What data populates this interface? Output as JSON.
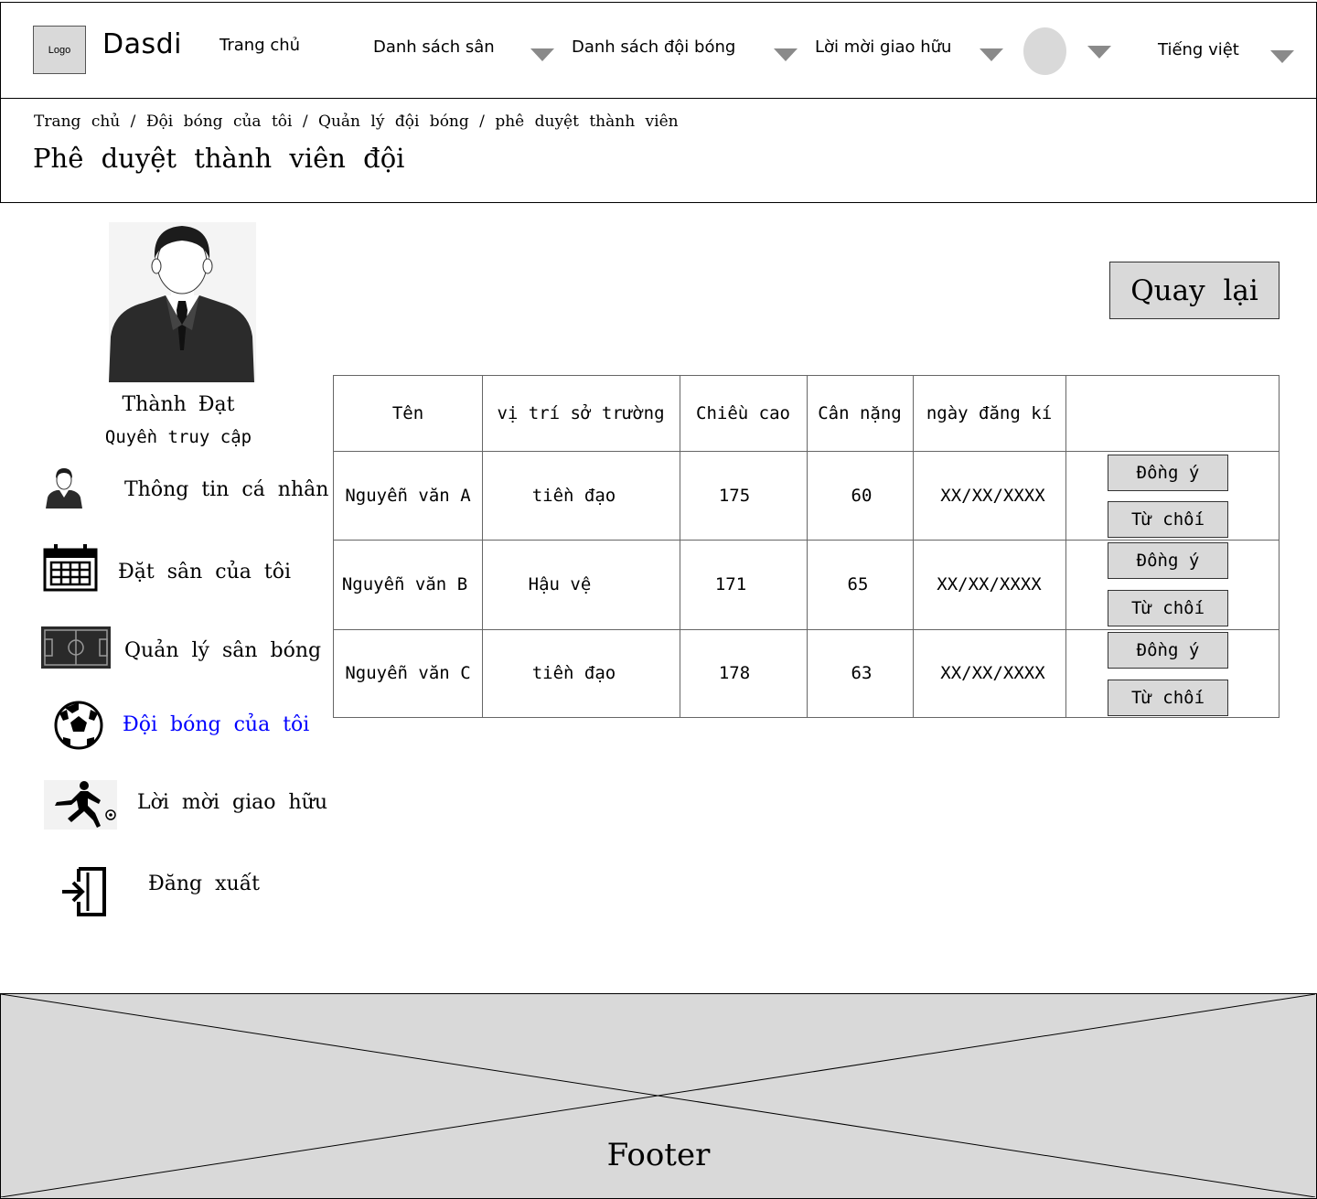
{
  "header": {
    "logo": "Logo",
    "brand": "Dasdi",
    "nav": {
      "home": "Trang chủ",
      "fields": "Danh sách sân",
      "teams": "Danh sách đội bóng",
      "invites": "Lời mời giao hữu",
      "language": "Tiếng việt"
    }
  },
  "breadcrumb": {
    "items": [
      "Trang chủ",
      "Đội bóng của tôi",
      "Quản lý đội bóng",
      "phê duyệt thành viên"
    ],
    "separator": "/"
  },
  "page_title": "Phê duyệt thành viên đội",
  "profile": {
    "name": "Thành Đạt",
    "role": "Quyền truy cập"
  },
  "sidebar": {
    "items": [
      {
        "label": "Thông tin cá nhân",
        "icon": "person-icon"
      },
      {
        "label": "Đặt sân của tôi",
        "icon": "calendar-icon"
      },
      {
        "label": "Quản lý sân bóng",
        "icon": "soccer-field-icon"
      },
      {
        "label": "Đội bóng của tôi",
        "icon": "soccer-ball-icon",
        "active": true
      },
      {
        "label": "Lời mời giao hữu",
        "icon": "soccer-player-icon"
      },
      {
        "label": "Đăng xuất",
        "icon": "logout-icon"
      }
    ],
    "active_color": "#0000ff"
  },
  "back_button": "Quay lại",
  "table": {
    "headers": [
      "Tên",
      "vị trí sở trường",
      "Chiều cao",
      "Cân nặng",
      "ngày đăng kí",
      ""
    ],
    "rows": [
      {
        "name": "Nguyễn văn A",
        "position": "tiền đạo",
        "height": "175",
        "weight": "60",
        "date": "XX/XX/XXXX",
        "approve": "Đồng ý",
        "reject": "Từ chối"
      },
      {
        "name": "Nguyễn văn B",
        "position": "Hậu vệ",
        "height": "171",
        "weight": "65",
        "date": "XX/XX/XXXX",
        "approve": "Đồng ý",
        "reject": "Từ chối"
      },
      {
        "name": "Nguyễn văn C",
        "position": "tiền đạo",
        "height": "178",
        "weight": "63",
        "date": "XX/XX/XXXX",
        "approve": "Đồng ý",
        "reject": "Từ chối"
      }
    ]
  },
  "footer": "Footer"
}
